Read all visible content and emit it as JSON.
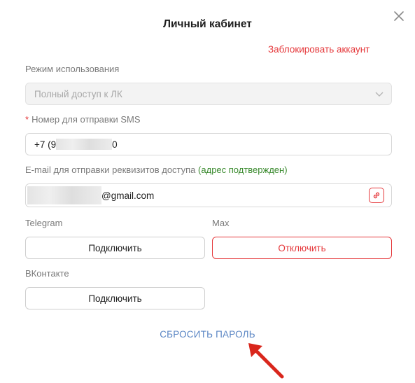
{
  "dialog": {
    "title": "Личный кабинет",
    "block_link": "Заблокировать аккаунт",
    "close_icon": "close-icon"
  },
  "usage_mode": {
    "label": "Режим использования",
    "value": "Полный доступ к ЛК",
    "icon": "chevron-down-icon"
  },
  "sms": {
    "required_mark": "*",
    "label": "Номер для отправки SMS",
    "value_prefix": "+7 (9",
    "value_suffix": "0"
  },
  "email": {
    "label": "E-mail для отправки реквизитов доступа",
    "status": "(адрес подтвержден)",
    "value_suffix": "@gmail.com",
    "icon": "copy-link-icon"
  },
  "telegram": {
    "label": "Telegram",
    "button": "Подключить"
  },
  "max": {
    "label": "Max",
    "button": "Отключить"
  },
  "vk": {
    "label": "ВКонтакте",
    "button": "Подключить"
  },
  "reset_password": "СБРОСИТЬ ПАРОЛЬ",
  "annotation": {
    "icon": "arrow-icon"
  },
  "colors": {
    "danger": "#e5383b",
    "confirmed": "#3a8a2e",
    "link": "#5b86c4",
    "label": "#7a7a7a"
  }
}
